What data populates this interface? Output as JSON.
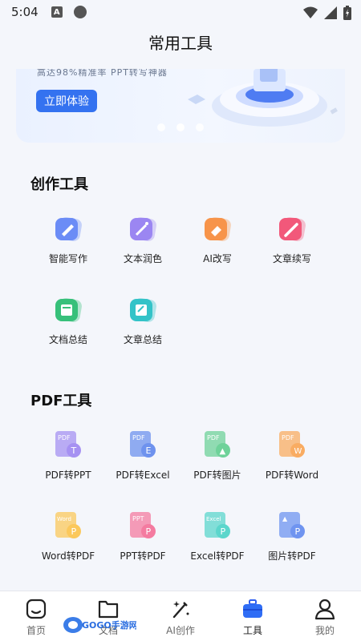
{
  "status": {
    "time": "5:04",
    "a_badge": "A"
  },
  "header": {
    "title": "常用工具"
  },
  "banner": {
    "subtitle": "高达98%精准率 PPT转写神器",
    "button_label": "立即体验",
    "active_dot": 1,
    "dot_count": 3
  },
  "create_section": {
    "title": "创作工具",
    "tools": [
      {
        "label": "智能写作",
        "icon": "smart-writing-icon",
        "color": "#6b8cf6"
      },
      {
        "label": "文本润色",
        "icon": "text-polish-icon",
        "color": "#9b86f2"
      },
      {
        "label": "AI改写",
        "icon": "ai-rewrite-icon",
        "color": "#f7944a"
      },
      {
        "label": "文章续写",
        "icon": "article-continue-icon",
        "color": "#f2587a"
      },
      {
        "label": "文档总结",
        "icon": "document-summary-icon",
        "color": "#37c07a"
      },
      {
        "label": "文章总结",
        "icon": "article-summary-icon",
        "color": "#33c3c8"
      }
    ]
  },
  "pdf_section": {
    "title": "PDF工具",
    "tools": [
      {
        "label": "PDF转PPT",
        "icon": "pdf-to-ppt-icon",
        "color": "#a691f2",
        "badge": "T",
        "top_text": "PDF"
      },
      {
        "label": "PDF转Excel",
        "icon": "pdf-to-excel-icon",
        "color": "#6e92ee",
        "badge": "E",
        "top_text": "PDF"
      },
      {
        "label": "PDF转图片",
        "icon": "pdf-to-image-icon",
        "color": "#6fd29a",
        "badge": "▲",
        "top_text": "PDF"
      },
      {
        "label": "PDF转Word",
        "icon": "pdf-to-word-icon",
        "color": "#f9ac62",
        "badge": "W",
        "top_text": "PDF"
      },
      {
        "label": "Word转PDF",
        "icon": "word-to-pdf-icon",
        "color": "#fbc85c",
        "badge": "P",
        "top_text": "Word"
      },
      {
        "label": "PPT转PDF",
        "icon": "ppt-to-pdf-icon",
        "color": "#f47ba0",
        "badge": "P",
        "top_text": "PPT"
      },
      {
        "label": "Excel转PDF",
        "icon": "excel-to-pdf-icon",
        "color": "#5cd6cc",
        "badge": "P",
        "top_text": "Excel"
      },
      {
        "label": "图片转PDF",
        "icon": "image-to-pdf-icon",
        "color": "#6f94f0",
        "badge": "P",
        "top_text": "▲"
      }
    ]
  },
  "tab_bar": {
    "active_index": 3,
    "items": [
      {
        "label": "首页",
        "icon": "home-icon"
      },
      {
        "label": "文档",
        "icon": "folder-icon"
      },
      {
        "label": "AI创作",
        "icon": "magic-wand-icon"
      },
      {
        "label": "工具",
        "icon": "toolbox-icon"
      },
      {
        "label": "我的",
        "icon": "profile-icon"
      }
    ]
  },
  "watermark": {
    "text": "GOGO手游网"
  }
}
